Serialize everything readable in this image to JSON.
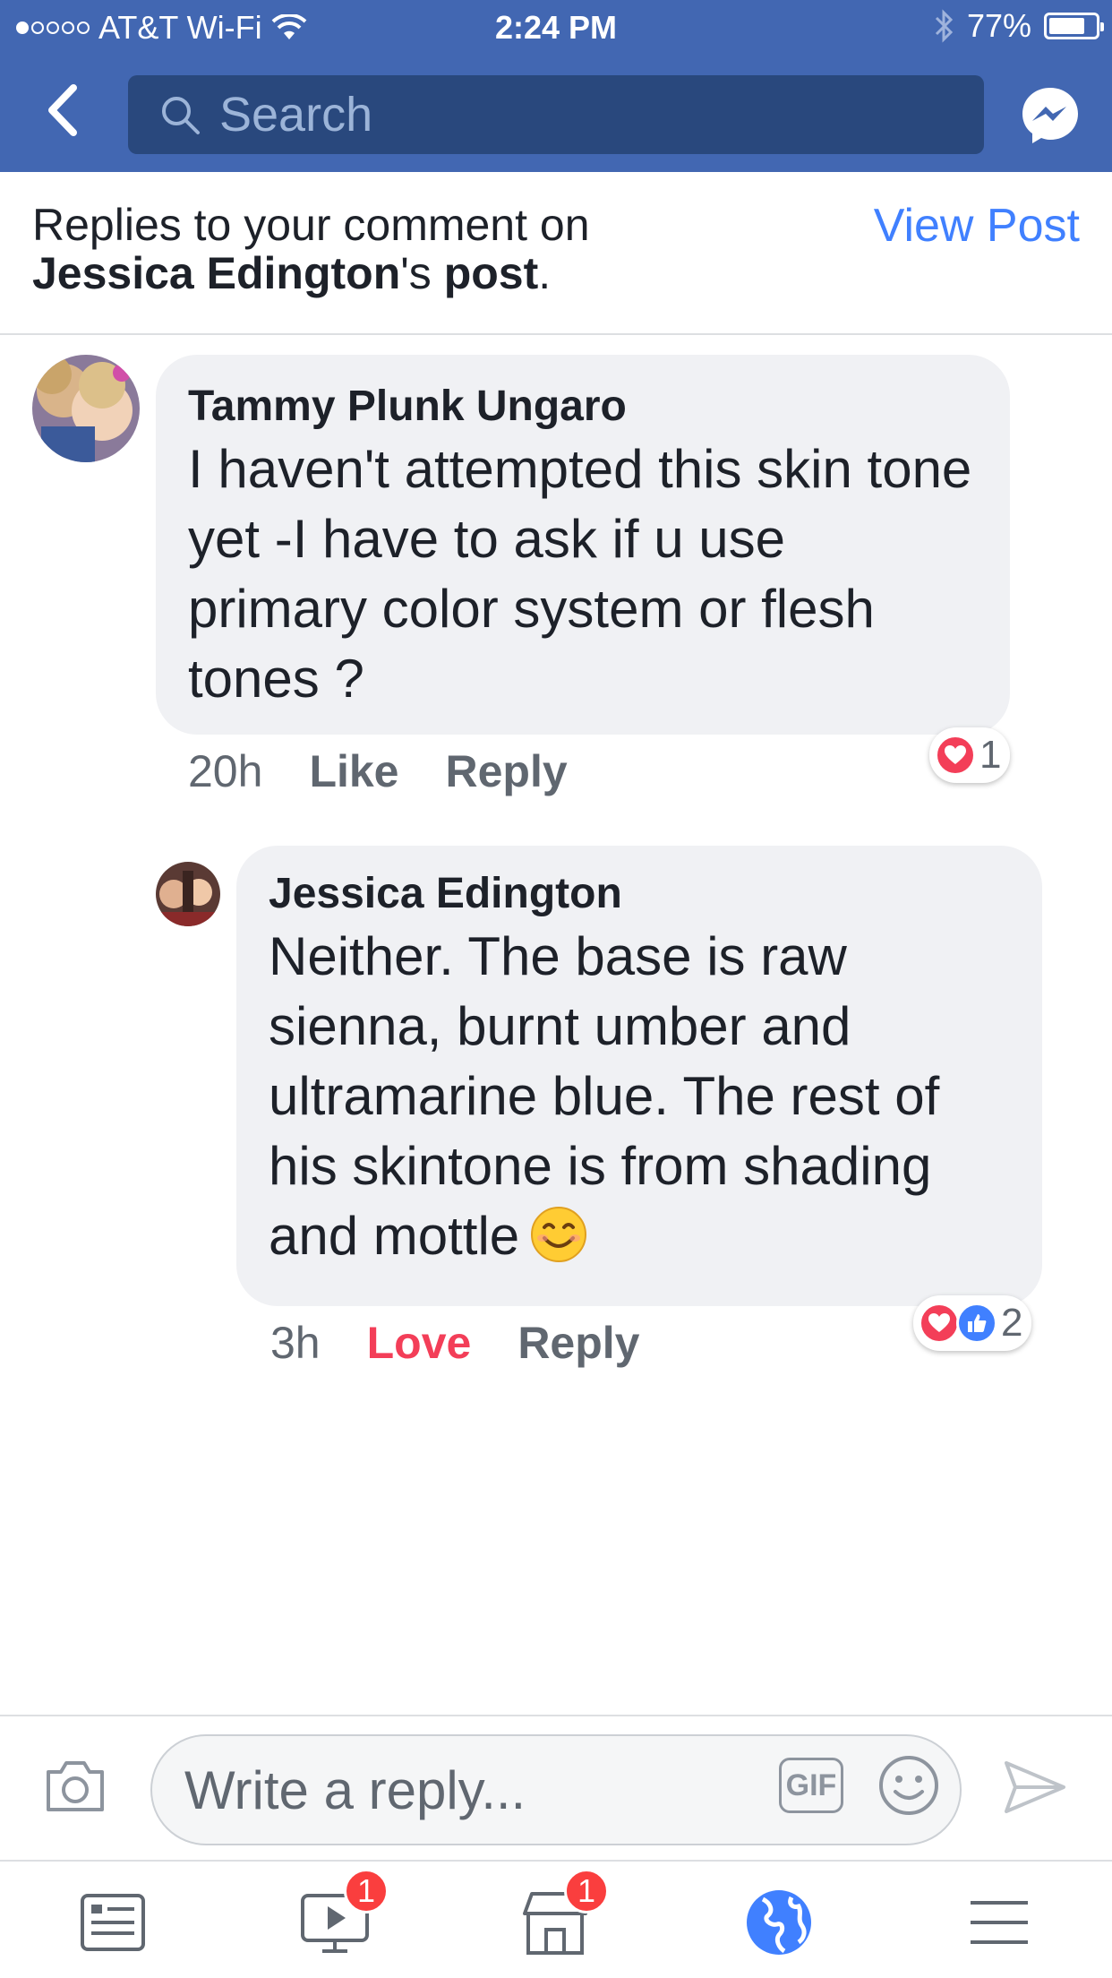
{
  "status_bar": {
    "carrier": "AT&T Wi-Fi",
    "time": "2:24 PM",
    "battery": "77%",
    "battery_level": 0.77,
    "signal_bars_filled": 1,
    "signal_bars_total": 5
  },
  "header": {
    "search_placeholder": "Search"
  },
  "replies_header": {
    "prefix": "Replies to your comment on",
    "author": "Jessica Edington",
    "possessive": "'s",
    "post_word": "post",
    "period": ".",
    "view_post": "View Post"
  },
  "comments": [
    {
      "author": "Tammy Plunk Ungaro",
      "text": "I haven't attempted this skin tone yet -I have to ask if u use primary color system or flesh tones ?",
      "time": "20h",
      "like_label": "Like",
      "reply_label": "Reply",
      "reaction_count": "1"
    },
    {
      "author": "Jessica Edington",
      "text": "Neither. The base is raw sienna, burnt umber and ultramarine blue. The rest of his skintone is from shading and mottle",
      "time": "3h",
      "like_label": "Love",
      "reply_label": "Reply",
      "reaction_count": "2"
    }
  ],
  "composer": {
    "placeholder": "Write a reply...",
    "gif_label": "GIF"
  },
  "tabbar": {
    "watch_badge": "1",
    "marketplace_badge": "1"
  },
  "colors": {
    "brand_blue": "#4267b2",
    "search_blue": "#29487d",
    "link_blue": "#4080ff",
    "love_red": "#f33e58",
    "badge_red": "#fa3e3e"
  }
}
